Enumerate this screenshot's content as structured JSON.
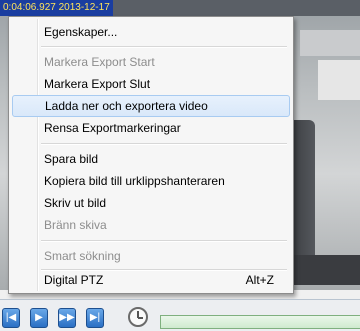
{
  "video": {
    "timestamp": "0:04:06.927 2013-12-17"
  },
  "context_menu": {
    "items": [
      {
        "label": "Egenskaper...",
        "enabled": true
      },
      {
        "label": "Markera Export Start",
        "enabled": false
      },
      {
        "label": "Markera Export Slut",
        "enabled": true
      },
      {
        "label": "Ladda ner och exportera video",
        "enabled": true,
        "highlighted": true
      },
      {
        "label": "Rensa Exportmarkeringar",
        "enabled": true
      },
      {
        "label": "Spara bild",
        "enabled": true
      },
      {
        "label": "Kopiera bild till urklippshanteraren",
        "enabled": true
      },
      {
        "label": "Skriv ut bild",
        "enabled": true
      },
      {
        "label": "Bränn skiva",
        "enabled": false
      },
      {
        "label": "Smart sökning",
        "enabled": false
      },
      {
        "label": "Digital PTZ",
        "enabled": true,
        "shortcut": "Alt+Z"
      }
    ]
  },
  "toolbar": {
    "icons": [
      "step-back-icon",
      "play-icon",
      "fast-forward-icon",
      "step-forward-icon",
      "clock-icon"
    ]
  }
}
